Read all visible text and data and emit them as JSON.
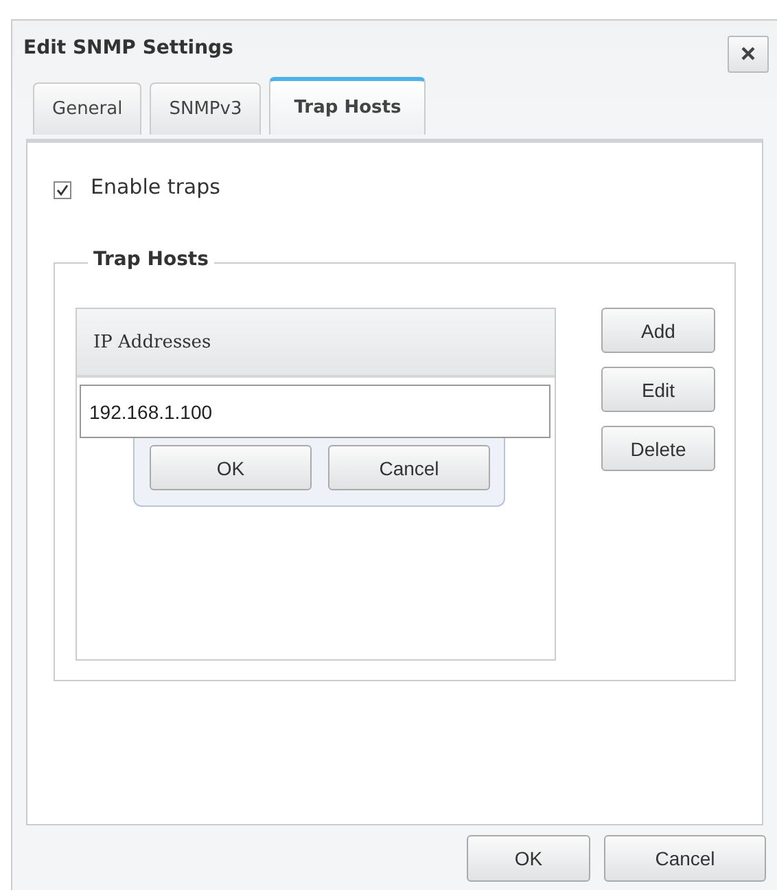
{
  "window": {
    "title": "Edit SNMP Settings"
  },
  "tabs": [
    {
      "label": "General",
      "selected": false
    },
    {
      "label": "SNMPv3",
      "selected": false
    },
    {
      "label": "Trap Hosts",
      "selected": true
    }
  ],
  "enable_traps": {
    "label": "Enable traps",
    "checked": true
  },
  "trap_hosts": {
    "title": "Trap Hosts",
    "list": {
      "header": "IP Addresses",
      "editor": {
        "value": "192.168.1.100",
        "buttons": [
          "OK",
          "Cancel"
        ]
      }
    },
    "buttons": [
      "Add",
      "Edit",
      "Delete"
    ]
  },
  "footer_buttons": [
    "OK",
    "Cancel"
  ]
}
